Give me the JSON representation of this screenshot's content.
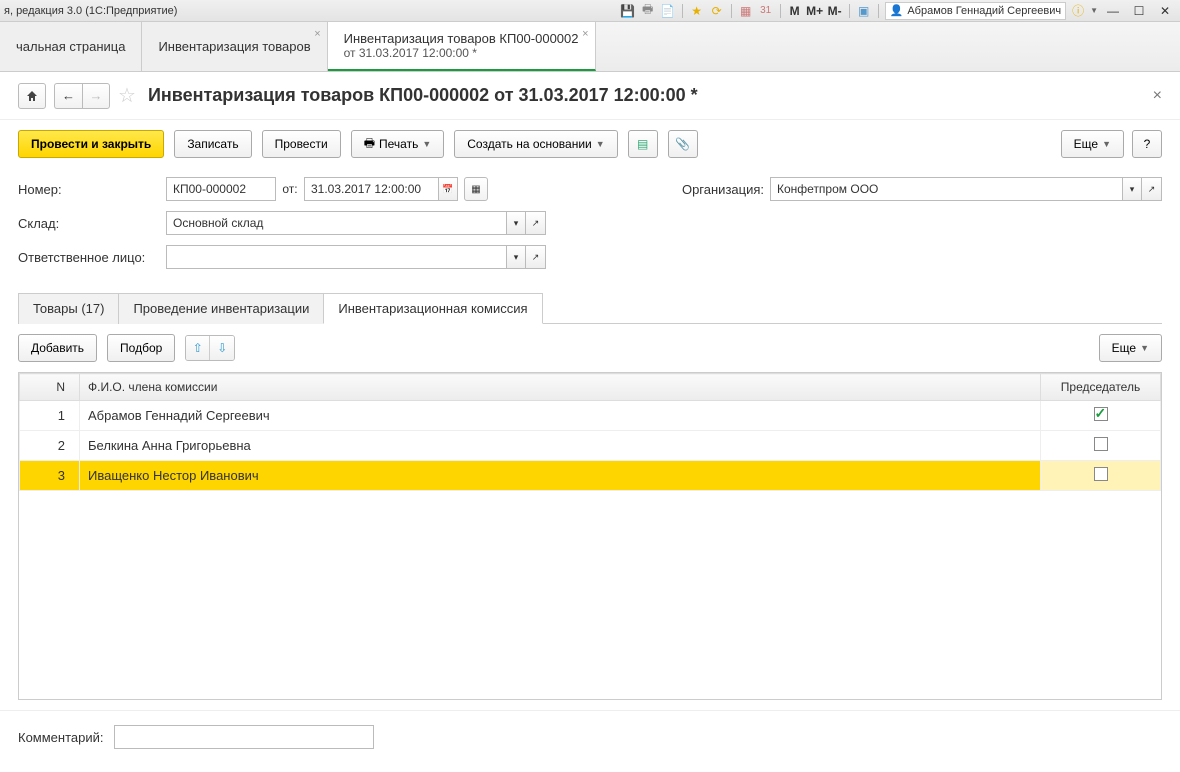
{
  "titlebar": {
    "app_suffix": "я, редакция 3.0  (1С:Предприятие)",
    "user_name": "Абрамов Геннадий Сергеевич",
    "m_label": "M",
    "m_plus": "M+",
    "m_minus": "M-"
  },
  "apptabs": [
    {
      "label": "чальная страница"
    },
    {
      "label": "Инвентаризация товаров",
      "closable": true
    },
    {
      "label": "Инвентаризация товаров КП00-000002",
      "sub": "от 31.03.2017 12:00:00 *",
      "closable": true,
      "active": true
    }
  ],
  "page_title": "Инвентаризация товаров КП00-000002 от 31.03.2017 12:00:00 *",
  "toolbar": {
    "post_close": "Провести и закрыть",
    "save": "Записать",
    "post": "Провести",
    "print": "Печать",
    "create_based": "Создать на основании",
    "more": "Еще",
    "help": "?"
  },
  "form": {
    "number_label": "Номер:",
    "number_value": "КП00-000002",
    "from_label": "от:",
    "date_value": "31.03.2017 12:00:00",
    "org_label": "Организация:",
    "org_value": "Конфетпром ООО",
    "warehouse_label": "Склад:",
    "warehouse_value": "Основной склад",
    "responsible_label": "Ответственное лицо:",
    "responsible_value": ""
  },
  "inner_tabs": {
    "goods": "Товары (17)",
    "audit": "Проведение инвентаризации",
    "commission": "Инвентаризационная комиссия"
  },
  "subtoolbar": {
    "add": "Добавить",
    "pick": "Подбор",
    "more": "Еще"
  },
  "grid": {
    "col_n": "N",
    "col_fio": "Ф.И.О. члена комиссии",
    "col_chair": "Председатель",
    "rows": [
      {
        "n": "1",
        "fio": "Абрамов Геннадий Сергеевич",
        "chair": true
      },
      {
        "n": "2",
        "fio": "Белкина Анна Григорьевна",
        "chair": false
      },
      {
        "n": "3",
        "fio": "Иващенко Нестор Иванович",
        "chair": false,
        "selected": true
      }
    ]
  },
  "comment_label": "Комментарий:"
}
